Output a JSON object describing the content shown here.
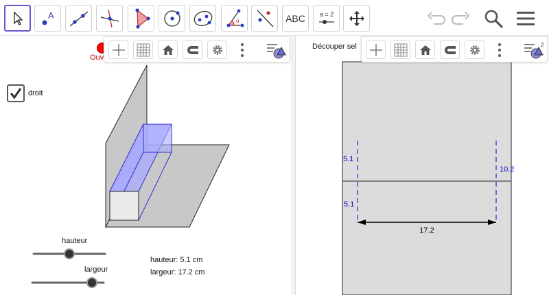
{
  "toolbar": {
    "tools": [
      {
        "name": "move-tool"
      },
      {
        "name": "point-tool",
        "label": "A"
      },
      {
        "name": "line-tool"
      },
      {
        "name": "perpendicular-line-tool"
      },
      {
        "name": "polygon-tool"
      },
      {
        "name": "circle-tool"
      },
      {
        "name": "ellipse-tool"
      },
      {
        "name": "angle-tool",
        "label": "α"
      },
      {
        "name": "reflect-tool"
      },
      {
        "name": "text-tool",
        "label": "ABC"
      },
      {
        "name": "slider-tool",
        "label": "a = 2"
      },
      {
        "name": "move-graphics-tool"
      }
    ],
    "undo_icon": "undo-icon",
    "redo_icon": "redo-icon",
    "search_icon": "search-icon",
    "menu_icon": "menu-icon"
  },
  "left_view": {
    "record_label": "Ouv",
    "checkbox_label": "droit",
    "checkbox_checked": true,
    "sliders": [
      {
        "label": "hauteur",
        "value": 5.1
      },
      {
        "label": "largeur",
        "value": 17.2
      }
    ],
    "info": {
      "hauteur": "hauteur: 5.1 cm",
      "largeur": "largeur: 17.2 cm"
    }
  },
  "right_view": {
    "title": "Découper sel",
    "labels": {
      "top_left": "5.1",
      "bottom_left": "5.1",
      "right": "10.2",
      "width": "17.2"
    },
    "style_bar_badge": "2"
  },
  "colors": {
    "accent": "#6557d2",
    "prism_fill": "#aaaaff",
    "prism_stroke": "#3333cc",
    "plane_fill": "#c8c8c8",
    "net_fill": "#dcdcdc",
    "label_blue": "#0000cc",
    "record_red": "#ff0000"
  }
}
